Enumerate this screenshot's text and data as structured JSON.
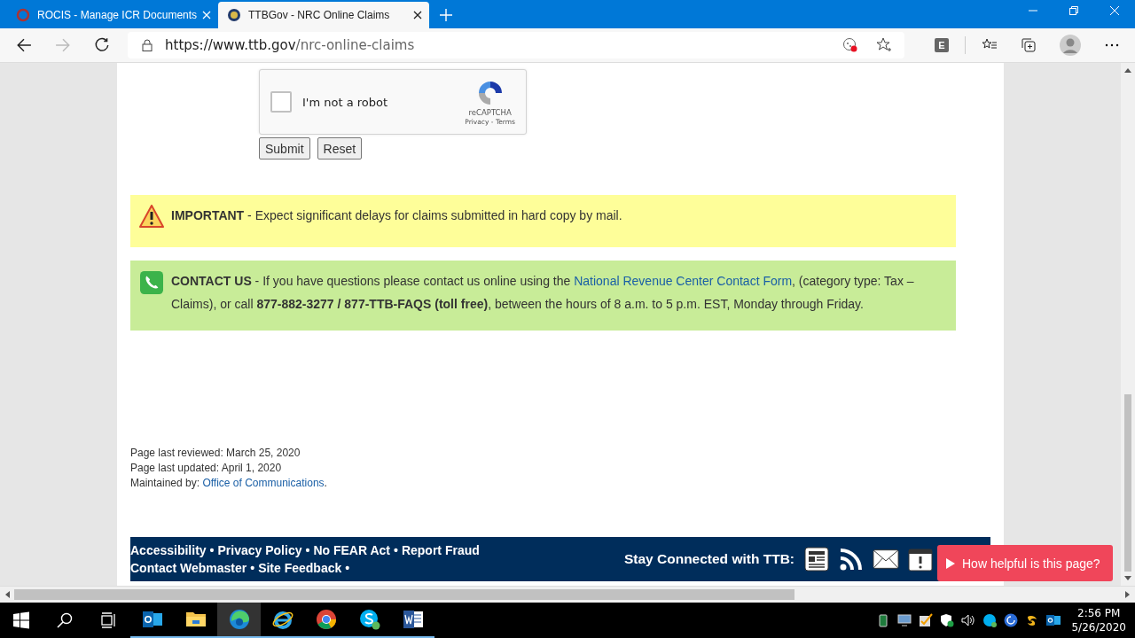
{
  "browser": {
    "tabs": [
      {
        "title": "ROCIS - Manage ICR Documents",
        "selected": false
      },
      {
        "title": "TTBGov - NRC Online Claims",
        "selected": true
      }
    ],
    "address": {
      "host": "https://www.ttb.gov",
      "path": "/nrc-online-claims"
    },
    "extension_letter": "E"
  },
  "captcha": {
    "label": "I'm not a robot",
    "checked": false,
    "brand": "reCAPTCHA",
    "terms": "Privacy - Terms"
  },
  "buttons": [
    "Submit",
    "Reset"
  ],
  "notices": [
    {
      "kind": "warning",
      "before": "**IMPORTANT** - Expect significant delays for claims submitted in hard copy by mail."
    },
    {
      "kind": "contact",
      "before": "**CONTACT US** - If you have questions please contact us online using the ",
      "link": "National Revenue Center Contact Form",
      "after": ", (category type: Tax – Claims), or call **877-882-3277 / 877-TTB-FAQS (toll free)**, between the hours of 8 a.m. to 5 p.m. EST, Monday through Friday."
    }
  ],
  "page_info": {
    "lines": [
      "Page last reviewed: March 25, 2020",
      "Page last updated: April 1, 2020"
    ],
    "maintained_label": "Maintained by: ",
    "maintained_link": "Office of Communications",
    "maintained_end": "."
  },
  "footer": {
    "separator": "•",
    "rows": [
      {
        "links": [
          "Accessibility",
          "Privacy Policy",
          "No FEAR Act",
          "Report Fraud"
        ],
        "trailing": false
      },
      {
        "links": [
          "Contact Webmaster",
          "Site Feedback"
        ],
        "trailing": true
      }
    ],
    "stay_connected": "Stay Connected with TTB:"
  },
  "feedback_button": "How helpful is this page?",
  "taskbar": {
    "apps": [
      {
        "kind": "outlook",
        "selected": false
      },
      {
        "kind": "folder",
        "selected": false
      },
      {
        "kind": "edge",
        "selected": true
      },
      {
        "kind": "ie",
        "selected": false
      },
      {
        "kind": "chrome",
        "selected": false
      },
      {
        "kind": "skype",
        "selected": false
      },
      {
        "kind": "word",
        "selected": false
      }
    ],
    "time": "2:56 PM",
    "date": "5/26/2020"
  }
}
